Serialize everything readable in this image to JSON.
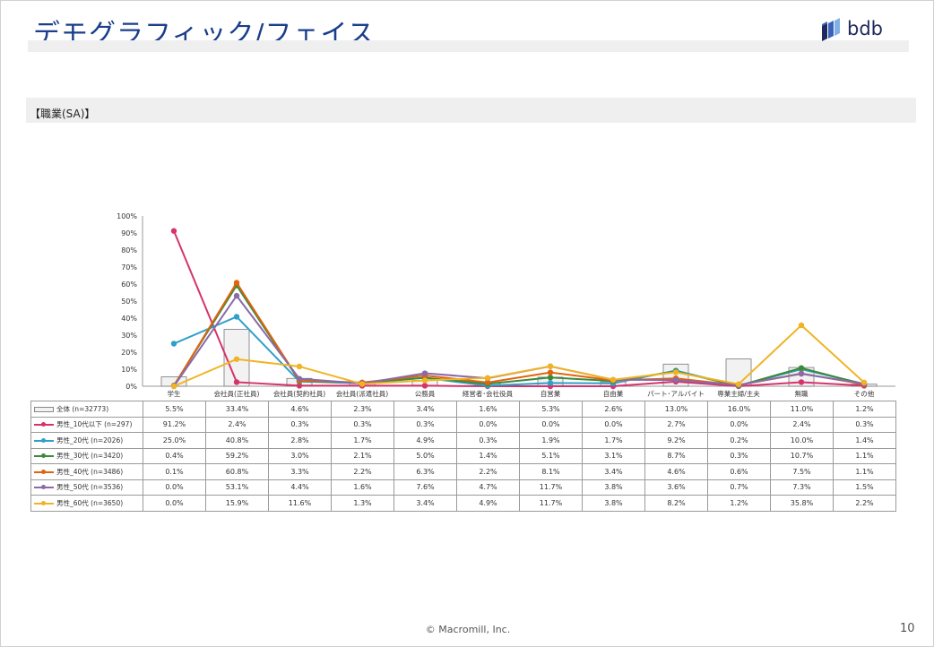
{
  "page": {
    "title": "デモグラフィック/フェイス",
    "logo_text": "bdb",
    "section_label": "【職業(SA)】",
    "footer": "© Macromill, Inc.",
    "page_number": "10"
  },
  "chart_data": {
    "type": "bar",
    "categories": [
      "学生",
      "会社員(正社員)",
      "会社員(契約社員)",
      "会社員(派遣社員)",
      "公務員",
      "経営者･会社役員",
      "自営業",
      "自由業",
      "パート･アルバイト",
      "専業主婦/主夫",
      "無職",
      "その他"
    ],
    "ylim": [
      0,
      100
    ],
    "yticks": [
      "0%",
      "10%",
      "20%",
      "30%",
      "40%",
      "50%",
      "60%",
      "70%",
      "80%",
      "90%",
      "100%"
    ],
    "series": [
      {
        "name": "全体 (n=32773)",
        "kind": "bar",
        "color": "#888888",
        "values": [
          5.5,
          33.4,
          4.6,
          2.3,
          3.4,
          1.6,
          5.3,
          2.6,
          13.0,
          16.0,
          11.0,
          1.2
        ]
      },
      {
        "name": "男性_10代以下 (n=297)",
        "kind": "line",
        "color": "#d6336c",
        "values": [
          91.2,
          2.4,
          0.3,
          0.3,
          0.3,
          0.0,
          0.0,
          0.0,
          2.7,
          0.0,
          2.4,
          0.3
        ]
      },
      {
        "name": "男性_20代 (n=2026)",
        "kind": "line",
        "color": "#2fa0c8",
        "values": [
          25.0,
          40.8,
          2.8,
          1.7,
          4.9,
          0.3,
          1.9,
          1.7,
          9.2,
          0.2,
          10.0,
          1.4
        ]
      },
      {
        "name": "男性_30代 (n=3420)",
        "kind": "line",
        "color": "#3b8a3b",
        "values": [
          0.4,
          59.2,
          3.0,
          2.1,
          5.0,
          1.4,
          5.1,
          3.1,
          8.7,
          0.3,
          10.7,
          1.1
        ]
      },
      {
        "name": "男性_40代 (n=3486)",
        "kind": "line",
        "color": "#e0640f",
        "values": [
          0.1,
          60.8,
          3.3,
          2.2,
          6.3,
          2.2,
          8.1,
          3.4,
          4.6,
          0.6,
          7.5,
          1.1
        ]
      },
      {
        "name": "男性_50代 (n=3536)",
        "kind": "line",
        "color": "#8a6aa8",
        "values": [
          0.0,
          53.1,
          4.4,
          1.6,
          7.6,
          4.7,
          11.7,
          3.8,
          3.6,
          0.7,
          7.3,
          1.5
        ]
      },
      {
        "name": "男性_60代 (n=3650)",
        "kind": "line",
        "color": "#f0b323",
        "values": [
          0.0,
          15.9,
          11.6,
          1.3,
          3.4,
          4.9,
          11.7,
          3.8,
          8.2,
          1.2,
          35.8,
          2.2
        ]
      }
    ]
  }
}
